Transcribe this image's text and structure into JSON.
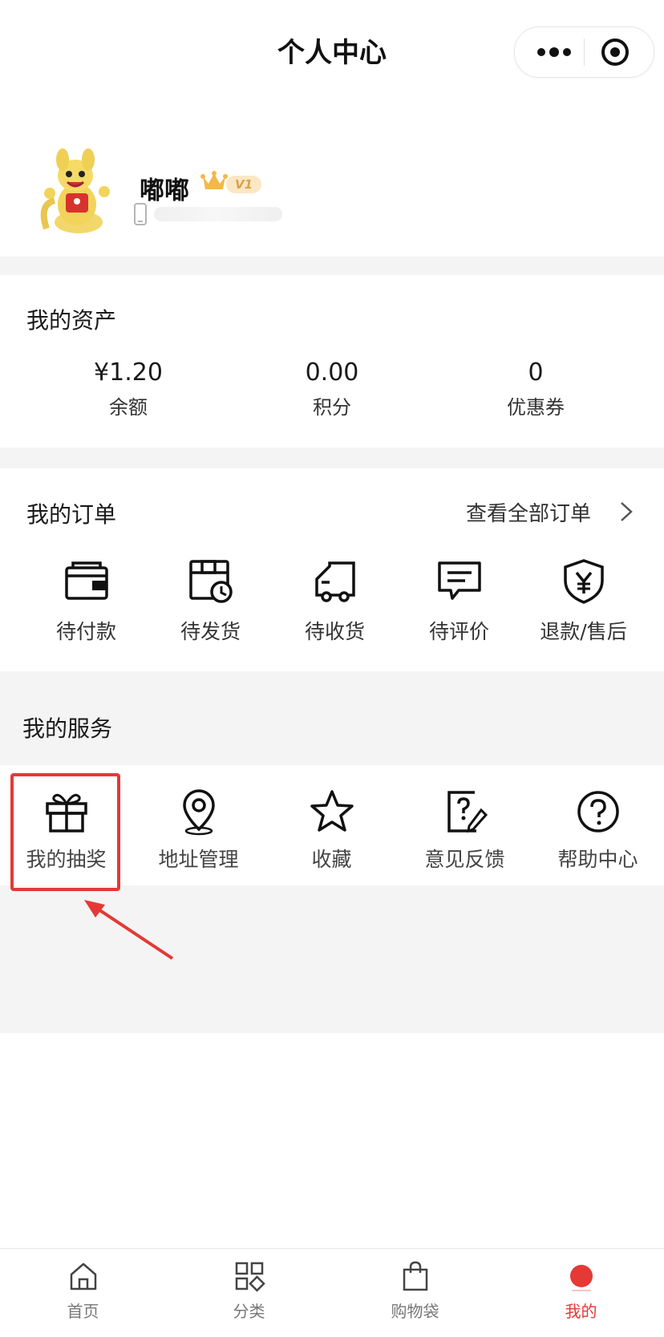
{
  "header": {
    "title": "个人中心",
    "more_icon": "more-dots-icon",
    "close_icon": "target-icon"
  },
  "profile": {
    "username": "嘟嘟",
    "level": "V1",
    "avatar_icon": "kangaroo-mascot-avatar",
    "crown_icon": "crown-icon",
    "phone_icon": "phone-icon"
  },
  "assets": {
    "title": "我的资产",
    "items": [
      {
        "value": "¥1.20",
        "label": "余额"
      },
      {
        "value": "0.00",
        "label": "积分"
      },
      {
        "value": "0",
        "label": "优惠券"
      }
    ]
  },
  "orders": {
    "title": "我的订单",
    "view_all": "查看全部订单",
    "items": [
      {
        "label": "待付款",
        "icon": "wallet-icon"
      },
      {
        "label": "待发货",
        "icon": "package-clock-icon"
      },
      {
        "label": "待收货",
        "icon": "truck-icon"
      },
      {
        "label": "待评价",
        "icon": "comment-icon"
      },
      {
        "label": "退款/售后",
        "icon": "shield-yen-icon"
      }
    ]
  },
  "services": {
    "title": "我的服务",
    "items": [
      {
        "label": "我的抽奖",
        "icon": "gift-icon"
      },
      {
        "label": "地址管理",
        "icon": "location-pin-icon"
      },
      {
        "label": "收藏",
        "icon": "star-icon"
      },
      {
        "label": "意见反馈",
        "icon": "feedback-edit-icon"
      },
      {
        "label": "帮助中心",
        "icon": "help-circle-icon"
      }
    ]
  },
  "tabbar": {
    "items": [
      {
        "label": "首页",
        "icon": "home-icon"
      },
      {
        "label": "分类",
        "icon": "category-grid-icon"
      },
      {
        "label": "购物袋",
        "icon": "shopping-bag-icon"
      },
      {
        "label": "我的",
        "icon": "profile-dot-icon",
        "active": true
      }
    ]
  },
  "colors": {
    "accent": "#e53935",
    "background": "#f4f4f4",
    "level_badge": "#fbe7c4"
  }
}
